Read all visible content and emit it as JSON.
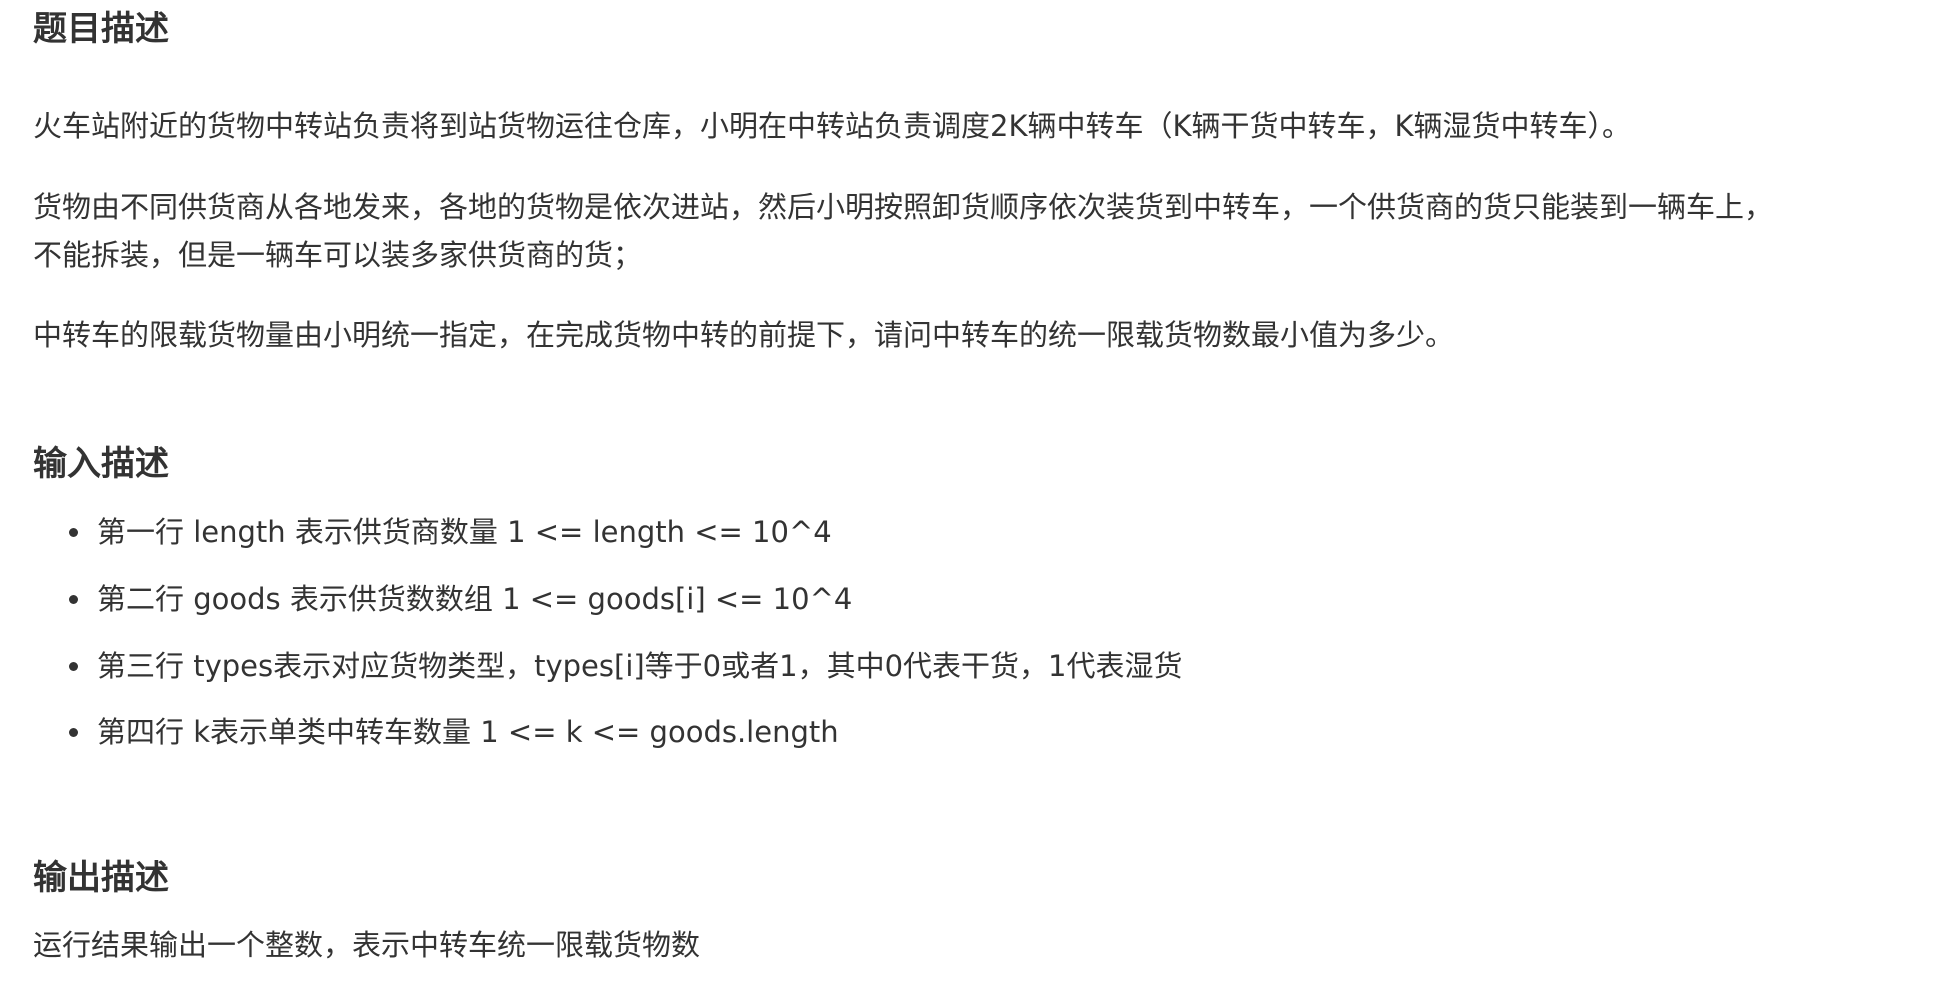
{
  "sections": {
    "description": {
      "heading": "题目描述",
      "paragraph1": "火车站附近的货物中转站负责将到站货物运往仓库，小明在中转站负责调度2K辆中转车（K辆干货中转车，K辆湿货中转车）。",
      "paragraph2_line1": "货物由不同供货商从各地发来，各地的货物是依次进站，然后小明按照卸货顺序依次装货到中转车，一个供货商的货只能装到一辆车上，",
      "paragraph2_line2": "不能拆装，但是一辆车可以装多家供货商的货；",
      "paragraph3": "中转车的限载货物量由小明统一指定，在完成货物中转的前提下，请问中转车的统一限载货物数最小值为多少。"
    },
    "input": {
      "heading": "输入描述",
      "items": [
        "第一行 length 表示供货商数量 1 <= length <= 10^4",
        "第二行 goods 表示供货数数组 1 <= goods[i] <= 10^4",
        "第三行 types表示对应货物类型，types[i]等于0或者1，其中0代表干货，1代表湿货",
        "第四行 k表示单类中转车数量 1 <= k <= goods.length"
      ]
    },
    "output": {
      "heading": "输出描述",
      "text": "运行结果输出一个整数，表示中转车统一限载货物数"
    }
  }
}
